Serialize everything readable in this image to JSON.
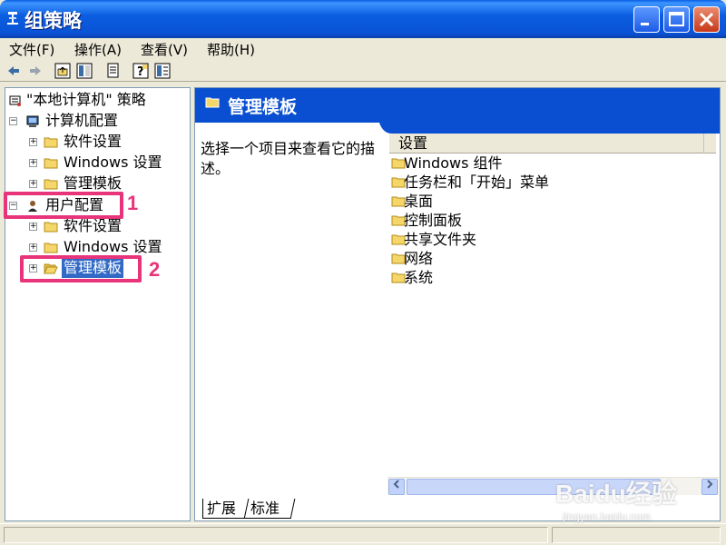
{
  "window": {
    "title": "组策略",
    "minimize_icon": "minimize-icon",
    "maximize_icon": "maximize-icon",
    "close_icon": "close-icon"
  },
  "menu": {
    "items": [
      "文件(F)",
      "操作(A)",
      "查看(V)",
      "帮助(H)"
    ]
  },
  "toolbar": {
    "icons": [
      "back-arrow-icon",
      "forward-arrow-icon",
      "up-folder-icon",
      "show-hide-tree-icon",
      "export-list-icon",
      "help-icon",
      "properties-icon"
    ]
  },
  "tree": {
    "root": "\"本地计算机\" 策略",
    "computer_config": "计算机配置",
    "computer_children": [
      "软件设置",
      "Windows 设置",
      "管理模板"
    ],
    "user_config": "用户配置",
    "user_children": [
      "软件设置",
      "Windows 设置",
      "管理模板"
    ]
  },
  "right_pane": {
    "header_title": "管理模板",
    "description": "选择一个项目来查看它的描述。",
    "column_header": "设置",
    "items": [
      "Windows 组件",
      "任务栏和「开始」菜单",
      "桌面",
      "控制面板",
      "共享文件夹",
      "网络",
      "系统"
    ],
    "tabs": [
      "扩展",
      "标准"
    ]
  },
  "annotations": {
    "label_1": "1",
    "label_2": "2",
    "color": "#e8347a"
  },
  "watermark": {
    "text": "Baidu经验",
    "sub": "jingyan.baidu.com"
  },
  "colors": {
    "titlebar": "#0a52d6",
    "header_band": "#0a4fd1",
    "selection": "#316ac5",
    "folder": "#f5d66b"
  }
}
